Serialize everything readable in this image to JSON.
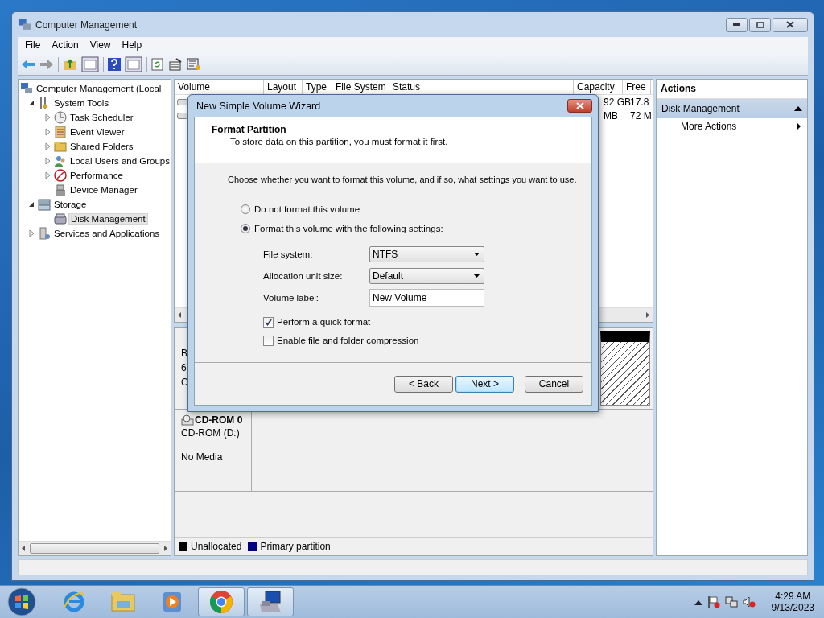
{
  "window": {
    "title": "Computer Management"
  },
  "menu": [
    "File",
    "Action",
    "View",
    "Help"
  ],
  "tree": [
    {
      "label": "Computer Management (Local",
      "kind": "computer",
      "selected": false,
      "children": [
        {
          "label": "System Tools",
          "kind": "tools",
          "expanded": true,
          "selected": false,
          "children": [
            {
              "label": "Task Scheduler",
              "kind": "clock",
              "expanded": false,
              "selected": false
            },
            {
              "label": "Event Viewer",
              "kind": "log",
              "expanded": false,
              "selected": false
            },
            {
              "label": "Shared Folders",
              "kind": "folder",
              "expanded": false,
              "selected": false
            },
            {
              "label": "Local Users and Groups",
              "kind": "users",
              "expanded": false,
              "selected": false
            },
            {
              "label": "Performance",
              "kind": "gauge",
              "expanded": false,
              "selected": false
            },
            {
              "label": "Device Manager",
              "kind": "device",
              "selected": false
            }
          ]
        },
        {
          "label": "Storage",
          "kind": "storage",
          "expanded": true,
          "selected": false,
          "children": [
            {
              "label": "Disk Management",
              "kind": "disk",
              "selected": true
            }
          ]
        },
        {
          "label": "Services and Applications",
          "kind": "services",
          "expanded": false,
          "selected": false
        }
      ]
    }
  ],
  "volume_list": {
    "columns": [
      "Volume",
      "Layout",
      "Type",
      "File System",
      "Status",
      "Capacity",
      "Free"
    ],
    "rows": [
      {
        "capacity": "92 GB",
        "free": "17.8"
      },
      {
        "capacity": "MB",
        "free": "72 M"
      }
    ]
  },
  "disk_panel": {
    "disks": [
      {
        "kind": "partial",
        "lines": [
          "B",
          "6",
          "O"
        ]
      },
      {
        "kind": "cdrom",
        "name": "CD-ROM 0",
        "drive": "CD-ROM (D:)",
        "media": "No Media"
      }
    ],
    "legend": [
      {
        "label": "Unallocated",
        "color": "#000000"
      },
      {
        "label": "Primary partition",
        "color": "#000080"
      }
    ]
  },
  "actions": {
    "title": "Actions",
    "section": "Disk Management",
    "items": [
      "More Actions"
    ]
  },
  "dialog": {
    "title": "New Simple Volume Wizard",
    "heading": "Format Partition",
    "subheading": "To store data on this partition, you must format it first.",
    "prompt": "Choose whether you want to format this volume, and if so, what settings you want to use.",
    "options": [
      {
        "label": "Do not format this volume",
        "selected": false
      },
      {
        "label": "Format this volume with the following settings:",
        "selected": true
      }
    ],
    "fields": [
      {
        "label": "File system:",
        "kind": "dropdown",
        "value": "NTFS"
      },
      {
        "label": "Allocation unit size:",
        "kind": "dropdown",
        "value": "Default"
      },
      {
        "label": "Volume label:",
        "kind": "text",
        "value": "New Volume"
      }
    ],
    "checkboxes": [
      {
        "label": "Perform a quick format",
        "checked": true
      },
      {
        "label": "Enable file and folder compression",
        "checked": false
      }
    ],
    "buttons": [
      {
        "label": "< Back",
        "default": false
      },
      {
        "label": "Next >",
        "default": true
      },
      {
        "label": "Cancel",
        "default": false
      }
    ]
  },
  "taskbar": {
    "apps": [
      {
        "kind": "ie",
        "selected": false
      },
      {
        "kind": "explorer",
        "selected": false
      },
      {
        "kind": "media",
        "selected": false
      },
      {
        "kind": "chrome",
        "selected": true
      },
      {
        "kind": "computer",
        "selected": true
      }
    ],
    "time": "4:29 AM",
    "date": "9/13/2023"
  }
}
